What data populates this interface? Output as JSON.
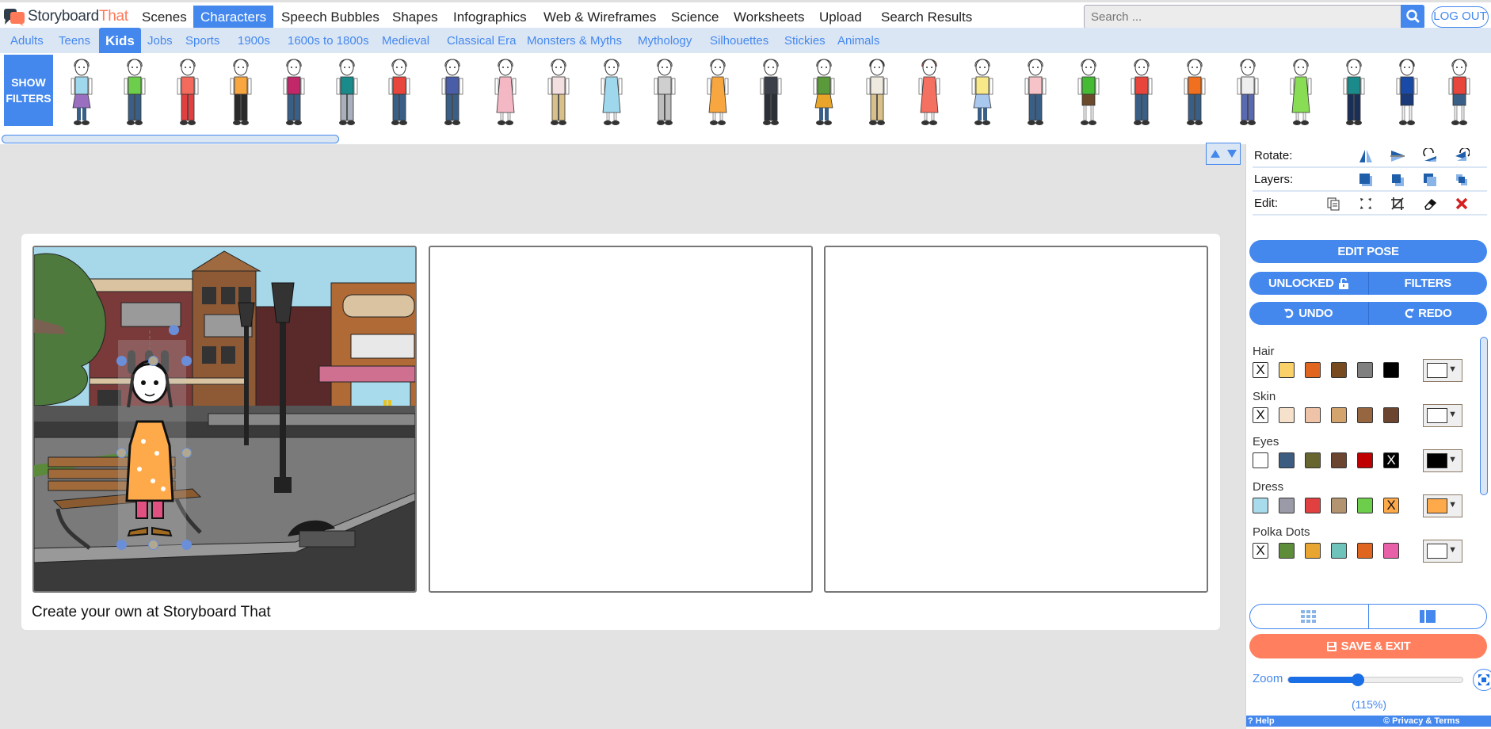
{
  "brand": {
    "name_part1": "Storyboard",
    "name_part2": "That"
  },
  "topnav": {
    "items": [
      "Scenes",
      "Characters",
      "Speech Bubbles",
      "Shapes",
      "Infographics",
      "Web & Wireframes",
      "Science",
      "Worksheets",
      "Upload",
      "Search Results"
    ],
    "active": "Characters",
    "search_placeholder": "Search ...",
    "logout_label": "LOG OUT"
  },
  "subnav": {
    "items": [
      "Adults",
      "Teens",
      "Kids",
      "Jobs",
      "Sports",
      "1900s",
      "1600s to 1800s",
      "Medieval",
      "Classical Era",
      "Monsters & Myths",
      "Mythology",
      "Silhouettes",
      "Stickies",
      "Animals"
    ],
    "active": "Kids"
  },
  "strip": {
    "show_filters_label": "SHOW FILTERS",
    "characters": [
      {
        "top": "#9fd8ec",
        "bottom": "#9b6fc0",
        "hair": "#ddd",
        "kind": "skirt"
      },
      {
        "top": "#6cce4a",
        "bottom": "#3a5f86",
        "hair": "#ddd",
        "kind": "pants"
      },
      {
        "top": "#f46b5e",
        "bottom": "#e04040",
        "hair": "#ddd",
        "kind": "pants"
      },
      {
        "top": "#f7a640",
        "bottom": "#2a2a2a",
        "hair": "#ddd",
        "kind": "pants"
      },
      {
        "top": "#c2276a",
        "bottom": "#3a5f86",
        "hair": "#ddd",
        "kind": "pants"
      },
      {
        "top": "#1a8a8a",
        "bottom": "#aab0bb",
        "hair": "#ddd",
        "kind": "pants"
      },
      {
        "top": "#e8453c",
        "bottom": "#3a5f86",
        "hair": "#ddd",
        "kind": "pants"
      },
      {
        "top": "#4a5ea8",
        "bottom": "#3a5f86",
        "hair": "#ddd",
        "kind": "pants"
      },
      {
        "top": "#f4b8c4",
        "bottom": "#f4b8c4",
        "hair": "#ddd",
        "kind": "dress"
      },
      {
        "top": "#f4dfe0",
        "bottom": "#d8c08a",
        "hair": "#ddd",
        "kind": "pants"
      },
      {
        "top": "#9fd8ec",
        "bottom": "#9fd8ec",
        "hair": "#ddd",
        "kind": "dress"
      },
      {
        "top": "#cfcfcf",
        "bottom": "#bdbdbd",
        "hair": "#ddd",
        "kind": "pants"
      },
      {
        "top": "#f7a640",
        "bottom": "#f7a640",
        "hair": "#ddd",
        "kind": "dress"
      },
      {
        "top": "#3a3f4a",
        "bottom": "#2a2f38",
        "hair": "#ddd",
        "kind": "pants"
      },
      {
        "top": "#5a9a3a",
        "bottom": "#e8a52a",
        "hair": "#ddd",
        "kind": "skirt"
      },
      {
        "top": "#eeeadf",
        "bottom": "#d8c08a",
        "hair": "#555",
        "kind": "pants"
      },
      {
        "top": "#f47060",
        "bottom": "#8a2232",
        "hair": "#f47060",
        "kind": "dress"
      },
      {
        "top": "#f8e88a",
        "bottom": "#a8c8ee",
        "hair": "#ddd",
        "kind": "skirt"
      },
      {
        "top": "#f6c4c8",
        "bottom": "#3a5f86",
        "hair": "#ddd",
        "kind": "pants"
      },
      {
        "top": "#44bb33",
        "bottom": "#6a4a2a",
        "hair": "#ddd",
        "kind": "shorts"
      },
      {
        "top": "#e8453c",
        "bottom": "#3a5f86",
        "hair": "#ddd",
        "kind": "pants"
      },
      {
        "top": "#f07020",
        "bottom": "#3a5f86",
        "hair": "#ddd",
        "kind": "pants"
      },
      {
        "top": "#eeeeee",
        "bottom": "#5a6ab0",
        "hair": "#ddd",
        "kind": "pants"
      },
      {
        "top": "#88dd55",
        "bottom": "#88dd55",
        "hair": "#ddd",
        "kind": "dress"
      },
      {
        "top": "#1a8a8a",
        "bottom": "#1a2f58",
        "hair": "#ddd",
        "kind": "pants"
      },
      {
        "top": "#1a4aa8",
        "bottom": "#1a3a78",
        "hair": "#666",
        "kind": "shorts"
      },
      {
        "top": "#e8453c",
        "bottom": "#3a5f86",
        "hair": "#ddd",
        "kind": "shorts"
      }
    ]
  },
  "storyboard": {
    "caption": "Create your own at Storyboard That",
    "panels": [
      {
        "scene": "town street with bench and lamp posts",
        "has_character": true
      },
      {
        "scene": "empty",
        "has_character": false
      },
      {
        "scene": "empty",
        "has_character": false
      }
    ]
  },
  "tools": {
    "rotate_label": "Rotate:",
    "layers_label": "Layers:",
    "edit_label": "Edit:",
    "rotate_icons": [
      "flip-horizontal-icon",
      "flip-vertical-icon",
      "rotate-left-icon",
      "rotate-right-icon"
    ],
    "layers_icons": [
      "bring-to-front-icon",
      "bring-forward-icon",
      "send-backward-icon",
      "send-to-back-icon"
    ],
    "edit_icons": [
      "copy-icon",
      "resize-icon",
      "crop-icon",
      "eraser-icon",
      "delete-icon"
    ]
  },
  "buttons": {
    "edit_pose": "EDIT POSE",
    "unlocked": "UNLOCKED",
    "filters": "FILTERS",
    "undo": "UNDO",
    "redo": "REDO",
    "save_exit": "SAVE & EXIT"
  },
  "colors": {
    "accent": "#4488ee",
    "save": "#ff7f5e",
    "groups": [
      {
        "label": "Hair",
        "swatches": [
          "none",
          "#f9d168",
          "#e06620",
          "#774a20",
          "#808080",
          "#000000"
        ],
        "selected_index": 0,
        "current": "#ffffff"
      },
      {
        "label": "Skin",
        "swatches": [
          "none",
          "#f6e2cc",
          "#eec3a8",
          "#d4a46e",
          "#956640",
          "#6b4530"
        ],
        "selected_index": 0,
        "current": "#ffffff"
      },
      {
        "label": "Eyes",
        "swatches": [
          "#ffffff",
          "#3d5d80",
          "#66662e",
          "#6b4530",
          "#c00000",
          "#000000"
        ],
        "selected_index": 5,
        "current": "#000000"
      },
      {
        "label": "Dress",
        "swatches": [
          "#a8dcec",
          "#9a9aa8",
          "#e04040",
          "#b39470",
          "#6cce4a",
          "#ffaa4a"
        ],
        "selected_index": 5,
        "current": "#ffaa4a"
      },
      {
        "label": "Polka Dots",
        "swatches": [
          "none",
          "#5e8d3a",
          "#e8a530",
          "#6ec3bb",
          "#e06620",
          "#e860a8"
        ],
        "selected_index": 0,
        "current": "#ffffff"
      }
    ]
  },
  "zoom": {
    "label": "Zoom",
    "value_text": "(115%)",
    "level_fraction": 0.4
  },
  "footer": {
    "help": "? Help",
    "privacy": "© Privacy & Terms"
  }
}
